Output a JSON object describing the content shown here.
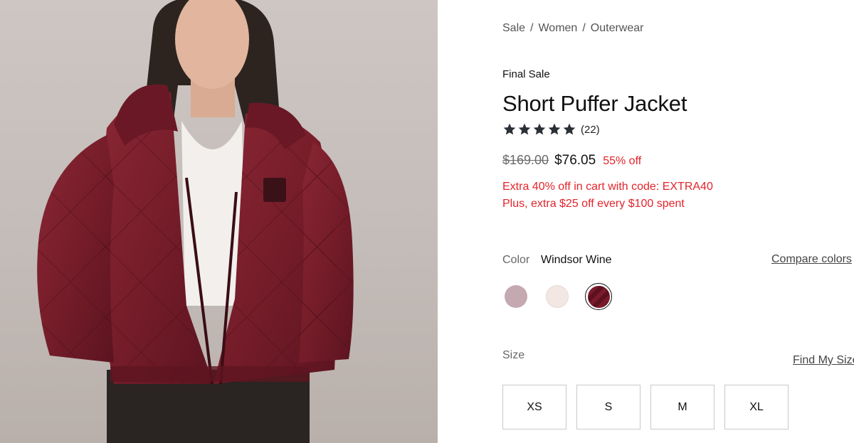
{
  "breadcrumb": {
    "items": [
      "Sale",
      "Women",
      "Outerwear"
    ],
    "separator": "/"
  },
  "product": {
    "badge": "Final Sale",
    "title": "Short Puffer Jacket",
    "rating": {
      "stars": 5,
      "count_label": "(22)"
    },
    "price": {
      "original": "$169.00",
      "sale": "$76.05",
      "discount": "55% off"
    },
    "promos": [
      "Extra 40% off in cart with code: EXTRA40",
      "Plus, extra $25 off every $100 spent"
    ]
  },
  "color": {
    "label": "Color",
    "selected": "Windsor Wine",
    "compare_link": "Compare colors",
    "swatches": [
      {
        "name": "mauve",
        "hex": "#c5a9b1"
      },
      {
        "name": "blush",
        "hex": "#f3e7e4"
      },
      {
        "name": "windsor-wine",
        "hex": "#6e1624",
        "selected": true
      }
    ]
  },
  "size": {
    "label": "Size",
    "find_link": "Find My Size",
    "options": [
      "XS",
      "S",
      "M",
      "XL"
    ]
  },
  "colors": {
    "sale_red": "#e3242b",
    "jacket": "#7a1f2b"
  }
}
